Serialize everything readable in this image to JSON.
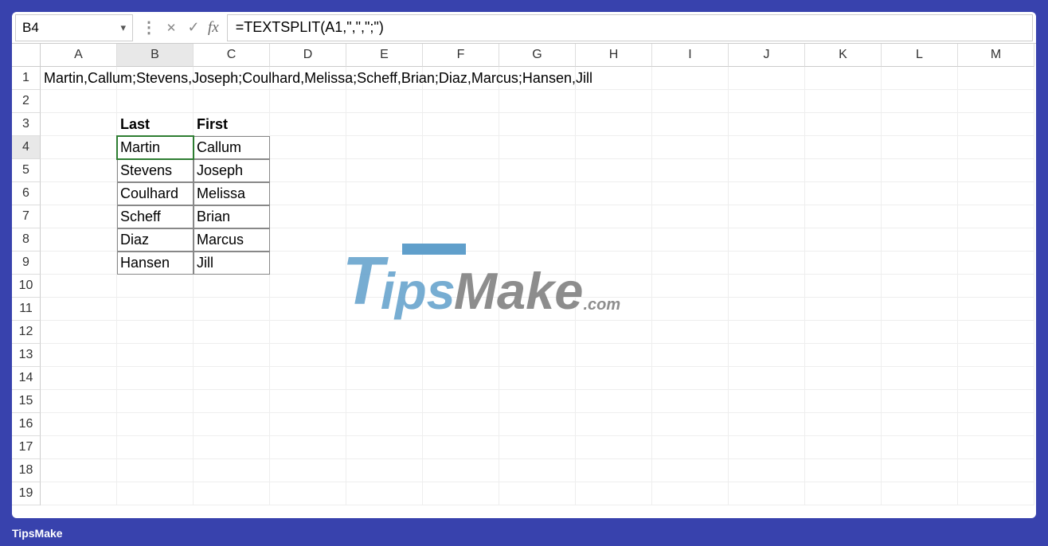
{
  "nameBox": "B4",
  "formula": "=TEXTSPLIT(A1,\",\",\";\")",
  "columns": [
    "A",
    "B",
    "C",
    "D",
    "E",
    "F",
    "G",
    "H",
    "I",
    "J",
    "K",
    "L",
    "M"
  ],
  "rows": [
    1,
    2,
    3,
    4,
    5,
    6,
    7,
    8,
    9,
    10,
    11,
    12,
    13,
    14,
    15,
    16,
    17,
    18,
    19
  ],
  "a1": "Martin,Callum;Stevens,Joseph;Coulhard,Melissa;Scheff,Brian;Diaz,Marcus;Hansen,Jill",
  "headers": {
    "b3": "Last",
    "c3": "First"
  },
  "names": [
    {
      "last": "Martin",
      "first": "Callum"
    },
    {
      "last": "Stevens",
      "first": "Joseph"
    },
    {
      "last": "Coulhard",
      "first": "Melissa"
    },
    {
      "last": "Scheff",
      "first": "Brian"
    },
    {
      "last": "Diaz",
      "first": "Marcus"
    },
    {
      "last": "Hansen",
      "first": "Jill"
    }
  ],
  "watermark": {
    "t": "T",
    "ips": "ips",
    "make": "Make",
    "com": ".com"
  },
  "footer": "TipsMake"
}
